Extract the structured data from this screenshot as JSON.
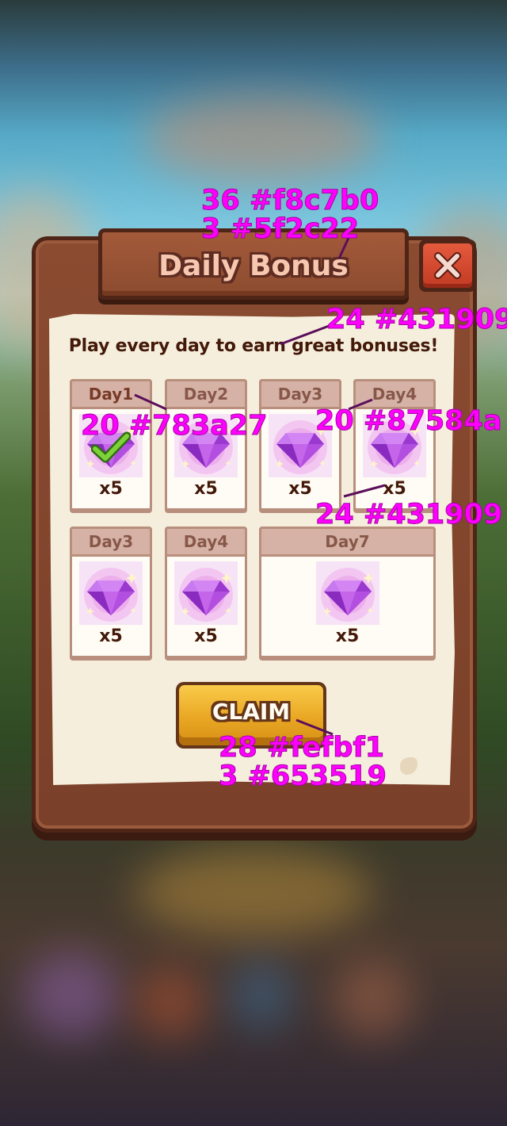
{
  "title": "Daily Bonus",
  "subtitle": "Play every day to earn great bonuses!",
  "claim_label": "CLAIM",
  "close_icon": "close-x-icon",
  "colors": {
    "title_fill": "#f8c7b0",
    "title_stroke": "#5f2c22",
    "subtitle": "#431909",
    "claimed_day_label": "#783a27",
    "day_label": "#87584a",
    "quantity": "#431909",
    "claim_fill": "#fefbf1",
    "claim_stroke": "#653519"
  },
  "days": [
    {
      "label": "Day1",
      "qty": "x5",
      "claimed": true,
      "icon": "purple-gem-icon"
    },
    {
      "label": "Day2",
      "qty": "x5",
      "claimed": false,
      "icon": "purple-gem-icon"
    },
    {
      "label": "Day3",
      "qty": "x5",
      "claimed": false,
      "icon": "purple-gem-icon"
    },
    {
      "label": "Day4",
      "qty": "x5",
      "claimed": false,
      "icon": "purple-gem-icon"
    },
    {
      "label": "Day3",
      "qty": "x5",
      "claimed": false,
      "icon": "purple-gem-icon"
    },
    {
      "label": "Day4",
      "qty": "x5",
      "claimed": false,
      "icon": "purple-gem-icon"
    },
    {
      "label": "Day7",
      "qty": "x5",
      "claimed": false,
      "icon": "purple-gem-icon"
    }
  ],
  "annotations": [
    {
      "text": "36 #f8c7b0"
    },
    {
      "text": "3 #5f2c22"
    },
    {
      "text": "24 #431909"
    },
    {
      "text": "20 #783a27"
    },
    {
      "text": "20 #87584a"
    },
    {
      "text": "24 #431909"
    },
    {
      "text": "28 #fefbf1"
    },
    {
      "text": "3 #653519"
    }
  ]
}
